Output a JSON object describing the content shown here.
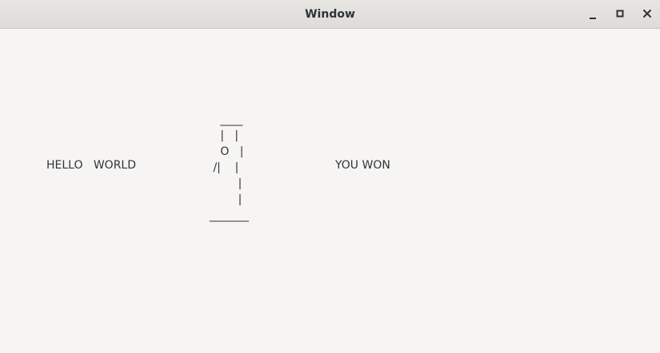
{
  "window": {
    "title": "Window",
    "controls": {
      "minimize_icon": "minimize-icon",
      "maximize_icon": "maximize-icon",
      "close_icon": "close-icon"
    }
  },
  "main": {
    "left_label": "HELLO   WORLD",
    "right_label": "YOU WON",
    "hangman_art": "   ____\n   |   |\n   O   |\n /|    |\n        |\n        |\n_______"
  }
}
